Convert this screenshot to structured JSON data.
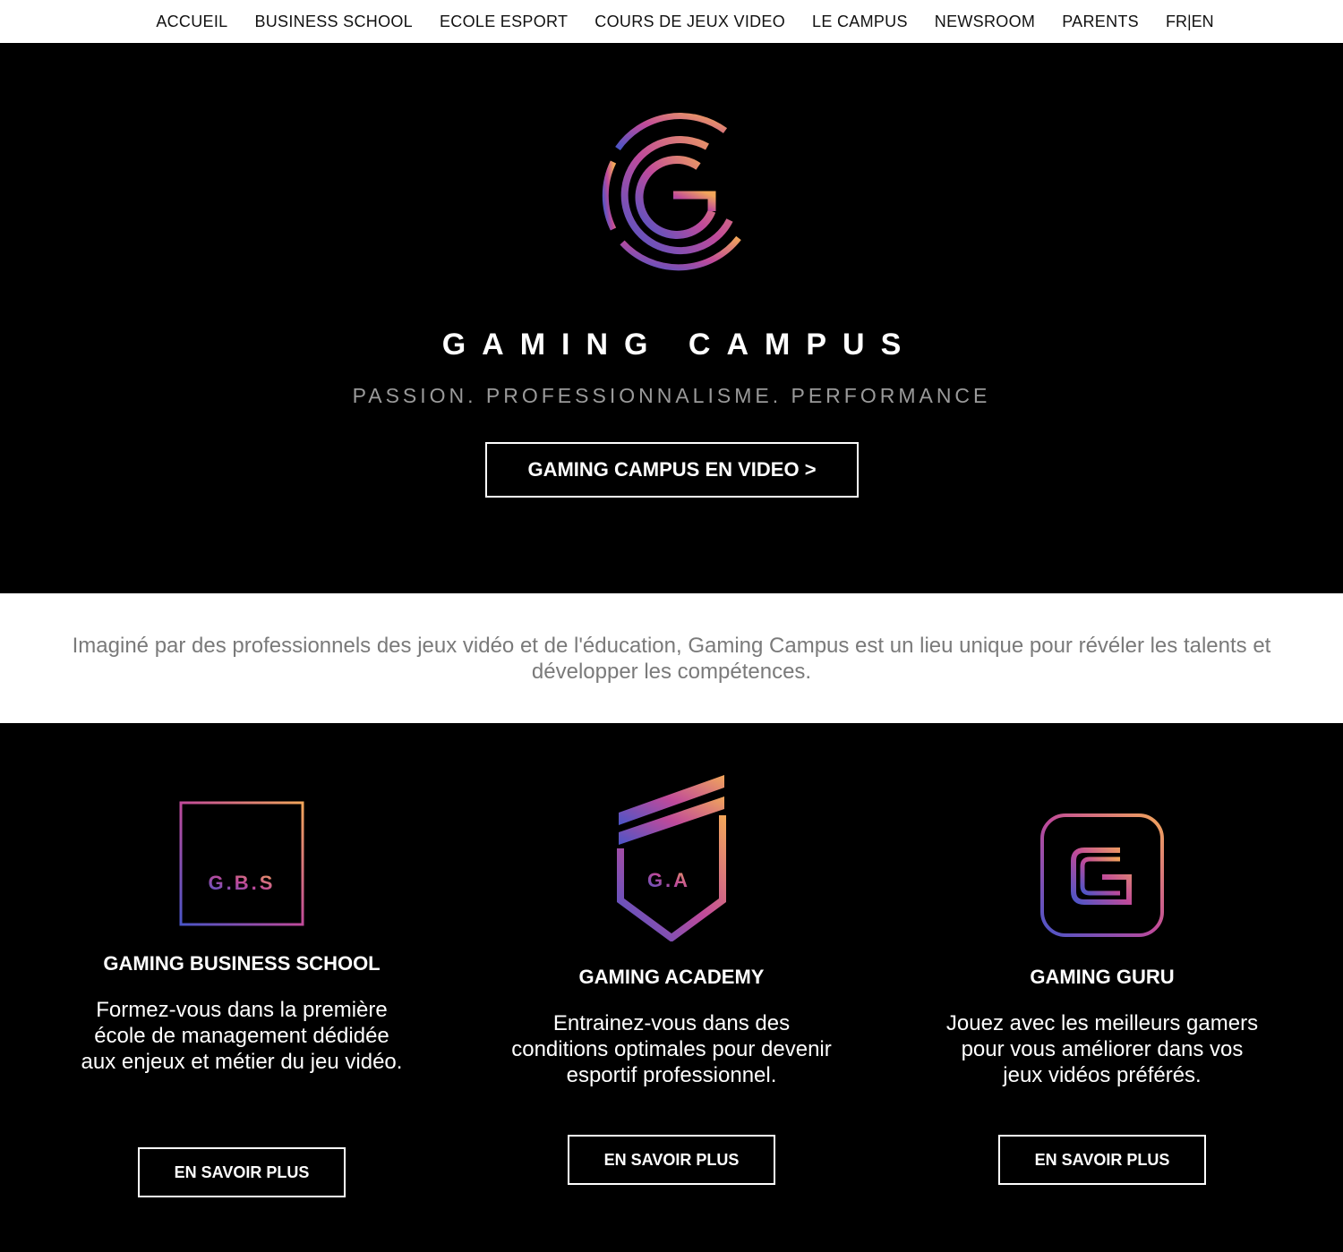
{
  "nav": {
    "items": [
      {
        "label": "ACCUEIL"
      },
      {
        "label": "BUSINESS SCHOOL"
      },
      {
        "label": "ECOLE ESPORT"
      },
      {
        "label": "COURS DE JEUX VIDEO"
      },
      {
        "label": "LE CAMPUS"
      },
      {
        "label": "NEWSROOM"
      },
      {
        "label": "PARENTS"
      }
    ],
    "lang": {
      "fr": "FR",
      "sep": "|",
      "en": "EN"
    }
  },
  "hero": {
    "brand": "GAMING CAMPUS",
    "tagline": "PASSION. PROFESSIONNALISME. PERFORMANCE",
    "video_button": "GAMING CAMPUS EN VIDEO >"
  },
  "intro": {
    "text": "Imaginé par des professionnels des jeux vidéo et de l'éducation, Gaming Campus est un lieu unique pour révéler les talents et développer les compétences."
  },
  "schools": [
    {
      "logo_text": "G.B.S",
      "title": "GAMING BUSINESS SCHOOL",
      "description": "Formez-vous dans la première école de management dédidée aux enjeux et métier du jeu vidéo.",
      "button": "EN SAVOIR PLUS"
    },
    {
      "logo_text": "G.A",
      "title": "GAMING ACADEMY",
      "description": "Entrainez-vous dans des conditions optimales pour devenir esportif professionnel.",
      "button": "EN SAVOIR PLUS"
    },
    {
      "logo_text": "",
      "title": "GAMING GURU",
      "description": "Jouez avec les meilleurs gamers pour vous améliorer dans vos jeux vidéos préférés.",
      "button": "EN SAVOIR PLUS"
    }
  ],
  "colors": {
    "gradient_start": "#f2a65a",
    "gradient_mid": "#c04a9a",
    "gradient_end": "#4a55c8",
    "text_muted": "#9a9a9a",
    "intro_text": "#7a7a7a"
  },
  "icons": {
    "hero": "gaming-campus-logo-icon",
    "gbs": "gbs-square-logo-icon",
    "ga": "ga-shield-logo-icon",
    "guru": "guru-rounded-g-icon"
  }
}
